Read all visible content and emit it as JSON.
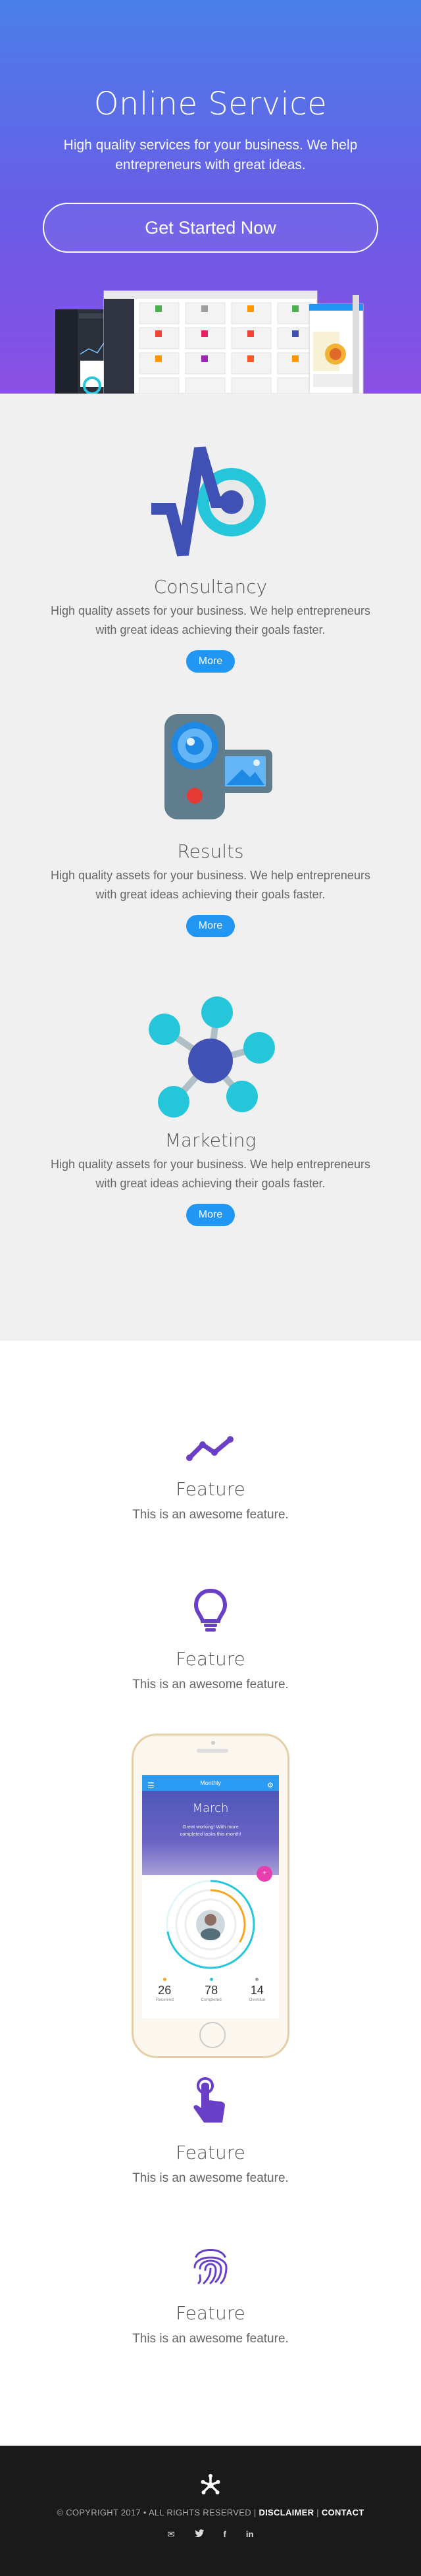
{
  "hero": {
    "title": "Online Service",
    "subtitle": "High quality services for your business. We help entrepreneurs with great ideas.",
    "cta_label": "Get Started Now"
  },
  "services": [
    {
      "title": "Consultancy",
      "text": "High quality assets for your business. We help entrepreneurs with great ideas achieving their goals faster.",
      "button": "More",
      "icon": "pulse-target-icon"
    },
    {
      "title": "Results",
      "text": "High quality assets for your business. We help entrepreneurs with great ideas achieving their goals faster.",
      "button": "More",
      "icon": "camcorder-icon"
    },
    {
      "title": "Marketing",
      "text": "High quality assets for your business. We help entrepreneurs with great ideas achieving their goals faster.",
      "button": "More",
      "icon": "network-icon"
    }
  ],
  "features": [
    {
      "title": "Feature",
      "text": "This is an awesome feature.",
      "icon": "trend-line-icon"
    },
    {
      "title": "Feature",
      "text": "This is an awesome feature.",
      "icon": "lightbulb-icon"
    },
    {
      "title": "Feature",
      "text": "This is an awesome feature.",
      "icon": "tap-hand-icon"
    },
    {
      "title": "Feature",
      "text": "This is an awesome feature.",
      "icon": "fingerprint-icon"
    }
  ],
  "phone_app": {
    "bar_title": "Monthly",
    "month": "March",
    "message": "Great working! With more completed tasks this month!",
    "stats": [
      {
        "value": "26",
        "label": "Received",
        "color": "#f5a623"
      },
      {
        "value": "78",
        "label": "Completed",
        "color": "#26c6da"
      },
      {
        "value": "14",
        "label": "Overdue",
        "color": "#999999"
      }
    ]
  },
  "footer": {
    "copyright": "© COPYRIGHT 2017 • ALL RIGHTS RESERVED |",
    "disclaimer": "DISCLAIMER",
    "separator": "|",
    "contact": "CONTACT",
    "socials": [
      "email-icon",
      "twitter-icon",
      "facebook-icon",
      "linkedin-icon"
    ]
  },
  "colors": {
    "hero_top": "#4a7fe8",
    "hero_bottom": "#8b4fe3",
    "button_blue": "#2196f3",
    "icon_purple": "#6a3fc8",
    "icon_navy": "#3f51b5",
    "icon_cyan": "#26c6da"
  }
}
